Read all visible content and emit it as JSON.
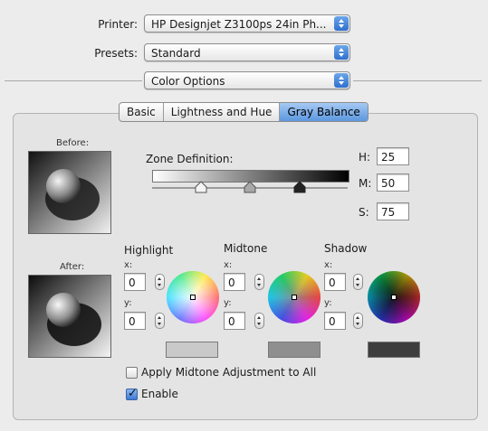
{
  "printer": {
    "label": "Printer:",
    "value": "HP Designjet Z3100ps 24in Ph..."
  },
  "presets": {
    "label": "Presets:",
    "value": "Standard"
  },
  "section": {
    "value": "Color Options"
  },
  "tabs": [
    {
      "label": "Basic",
      "selected": false
    },
    {
      "label": "Lightness and Hue",
      "selected": false
    },
    {
      "label": "Gray Balance",
      "selected": true
    }
  ],
  "before": {
    "label": "Before:"
  },
  "after": {
    "label": "After:"
  },
  "zone": {
    "label": "Zone Definition:",
    "h_label": "H:",
    "h": "25",
    "m_label": "M:",
    "m": "50",
    "s_label": "S:",
    "s": "75"
  },
  "groups": [
    {
      "title": "Highlight",
      "x_label": "x:",
      "x": "0",
      "y_label": "y:",
      "y": "0",
      "swatch": "#c9c9c9"
    },
    {
      "title": "Midtone",
      "x_label": "x:",
      "x": "0",
      "y_label": "y:",
      "y": "0",
      "swatch": "#8f8f8f"
    },
    {
      "title": "Shadow",
      "x_label": "x:",
      "x": "0",
      "y_label": "y:",
      "y": "0",
      "swatch": "#3e3e3e"
    }
  ],
  "apply_all": {
    "label": "Apply Midtone Adjustment to All",
    "checked": false
  },
  "enable": {
    "label": "Enable",
    "checked": true
  }
}
